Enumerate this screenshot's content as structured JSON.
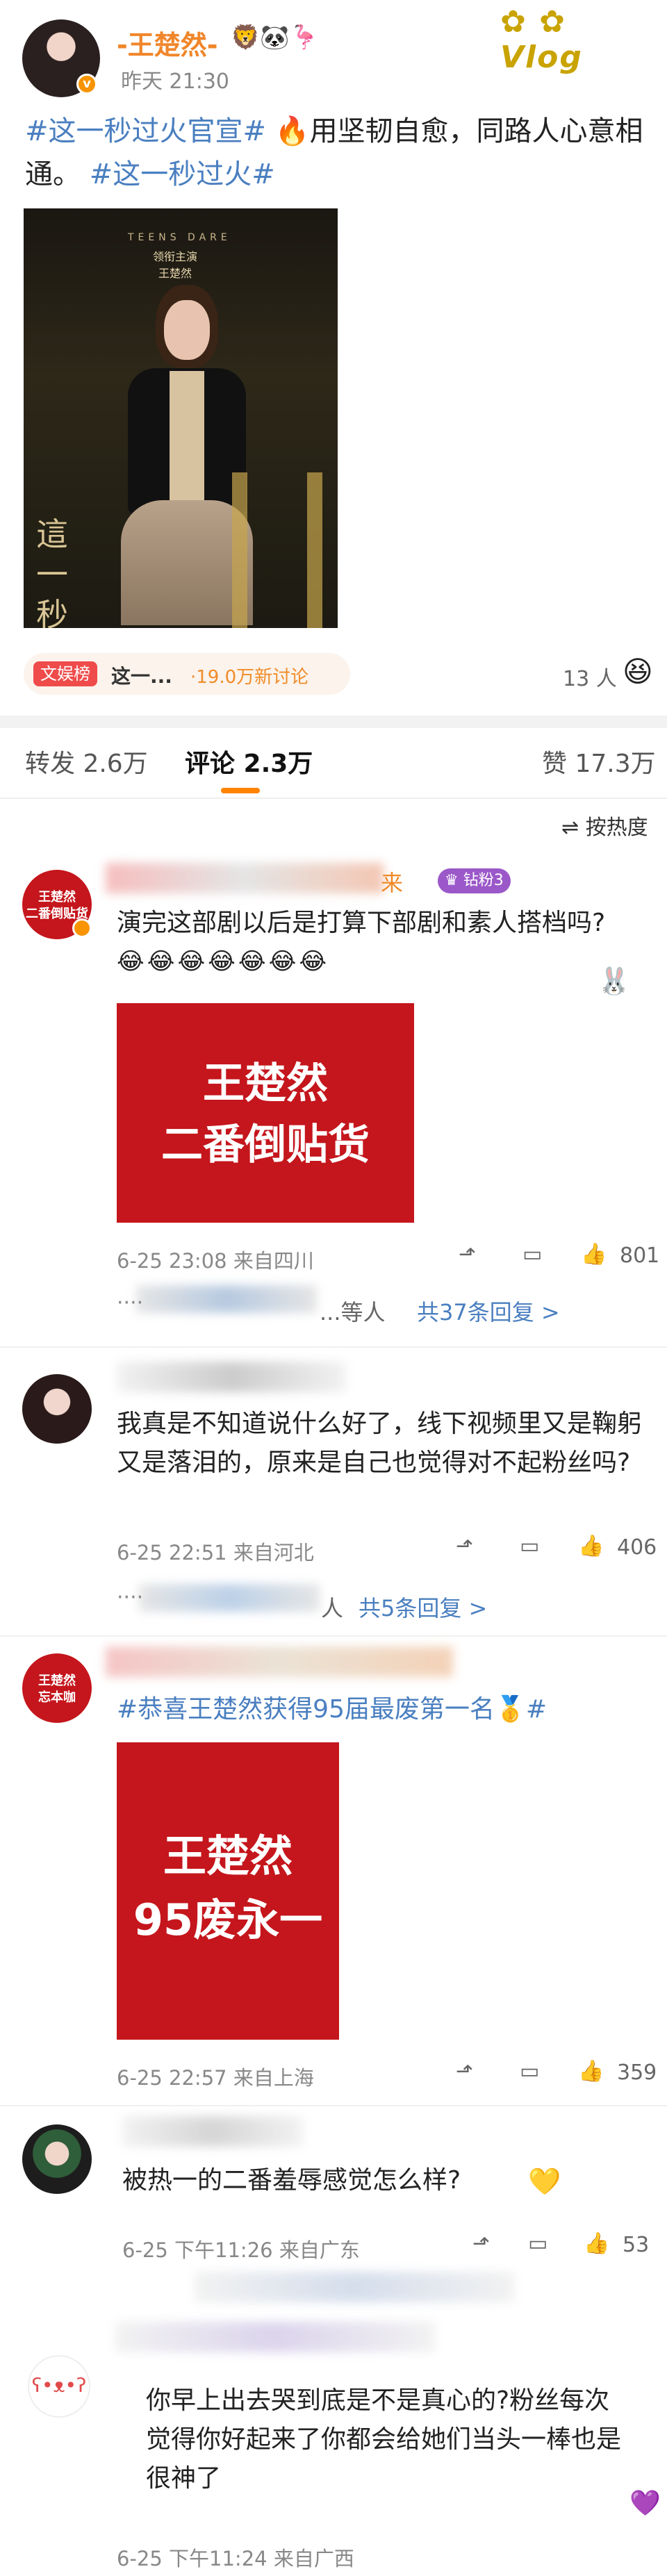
{
  "post": {
    "author": "-王楚然-",
    "time": "昨天 21:30",
    "text_tag1": "#这一秒过火官宣#",
    "text_body": "用坚韧自愈，同路人心意相通。",
    "text_tag2": "#这一秒过火#",
    "poster_top": "TEENS  DARE",
    "poster_name": "领衔主演\n王楚然",
    "poster_title": "這一秒",
    "topic_badge": "文娱榜",
    "topic_text": "这一...",
    "topic_count": "·19.0万新讨论",
    "people_count": "13 人"
  },
  "tabs": {
    "repost": "转发 2.6万",
    "comment": "评论 2.3万",
    "like": "赞 17.3万",
    "sort": "按热度"
  },
  "comments": [
    {
      "avatar_text": "王楚然\n二番倒贴货",
      "level_badge": "钻粉3",
      "text": "演完这部剧以后是打算下部剧和素人搭档吗?",
      "card_text": "王楚然\n二番倒贴货",
      "time": "6-25 23:08  来自四川",
      "likes": "801",
      "replies_suffix": "...等人",
      "replies_link": "共37条回复 >"
    },
    {
      "text": "我真是不知道说什么好了，线下视频里又是鞠躬又是落泪的，原来是自己也觉得对不起粉丝吗?",
      "time": "6-25 22:51  来自河北",
      "likes": "406",
      "replies_suffix": "人",
      "replies_link": "共5条回复 >"
    },
    {
      "avatar_text": "王楚然\n忘本咖",
      "text": "#恭喜王楚然获得95届最废第一名",
      "text_tail": "#",
      "card_text": "王楚然\n95废永一",
      "time": "6-25 22:57  来自上海",
      "likes": "359"
    },
    {
      "text": "被热一的二番羞辱感觉怎么样?",
      "time": "6-25 下午11:26  来自广东",
      "likes": "53"
    },
    {
      "text": "你早上出去哭到底是不是真心的?粉丝每次觉得你好起来了你都会给她们当头一棒也是很神了",
      "time": "6-25 下午11:24  来自广西"
    }
  ],
  "colors": {
    "accent": "#ff8200",
    "link": "#4a7fc0",
    "red": "#c4161c"
  }
}
